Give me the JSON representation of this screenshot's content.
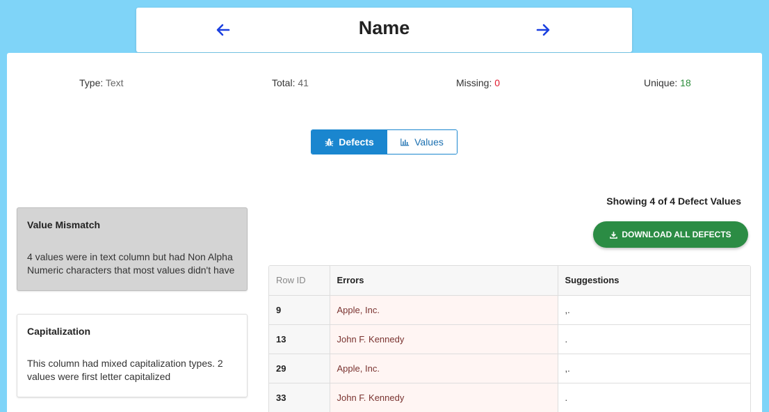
{
  "header": {
    "title": "Name"
  },
  "stats": {
    "type_label": "Type:",
    "type_value": "Text",
    "total_label": "Total:",
    "total_value": "41",
    "missing_label": "Missing:",
    "missing_value": "0",
    "unique_label": "Unique:",
    "unique_value": "18"
  },
  "tabs": {
    "defects_label": "Defects",
    "values_label": "Values"
  },
  "defects": [
    {
      "title": "Value Mismatch",
      "description": "4 values were in text column but had Non Alpha Numeric characters that most values didn't have"
    },
    {
      "title": "Capitalization",
      "description": "This column had mixed capitalization types. 2 values were first letter capitalized"
    }
  ],
  "results": {
    "showing": "Showing 4 of 4 Defect Values",
    "download_label": "DOWNLOAD ALL DEFECTS"
  },
  "table": {
    "columns": [
      "Row ID",
      "Errors",
      "Suggestions"
    ],
    "rows": [
      {
        "row_id": "9",
        "error": "Apple, Inc.",
        "suggestion": ",."
      },
      {
        "row_id": "13",
        "error": "John F. Kennedy",
        "suggestion": "."
      },
      {
        "row_id": "29",
        "error": "Apple, Inc.",
        "suggestion": ",."
      },
      {
        "row_id": "33",
        "error": "John F. Kennedy",
        "suggestion": "."
      }
    ]
  },
  "colors": {
    "background": "#7fd4f8",
    "accent_blue": "#1a86cf",
    "nav_arrow": "#1a3fe0",
    "download_green": "#2b8c44",
    "missing_red": "#e0182d",
    "unique_green": "#2b8c3a"
  },
  "icons": {
    "prev": "arrow-left-icon",
    "next": "arrow-right-icon",
    "defects": "bug-icon",
    "values": "bar-chart-icon",
    "download": "download-icon"
  }
}
